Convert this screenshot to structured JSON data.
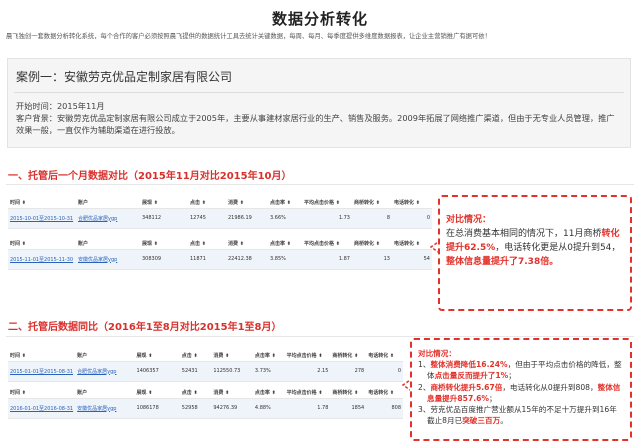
{
  "page": {
    "title": "数据分析转化",
    "intro": "晨飞独创一套数据分析转化系统，每个合作的客户必须按照晨飞提供的数据统计工具去统计关键数据，每周、每月、每季度提供多维度数据报表，让企业主营销推广有据可依！"
  },
  "case": {
    "title": "案例一：安徽劳克优品定制家居有限公司",
    "start_label": "开始时间：",
    "start_value": "2015年11月",
    "bg_label": "客户背景：",
    "bg_text": "安徽劳克优品定制家居有限公司成立于2005年，主要从事建材家居行业的生产、销售及服务。2009年拓展了网络推广渠道，但由于无专业人员管理，推广效果一般，一直仅作为辅助渠道在进行投放。"
  },
  "section1": {
    "heading": "一、托管后一个月数据对比（2015年11月对比2015年10月）",
    "headers": [
      "时间 ⬍",
      "账户",
      "展现 ⬍",
      "点击 ⬍",
      "消费 ⬍",
      "点击率 ⬍",
      "平均点击价格 ⬍",
      "商桥转化 ⬍",
      "电话转化 ⬍"
    ],
    "rows": [
      [
        "2015-10-01至2015-10-31",
        "合肥优品家居ygp",
        "348112",
        "12745",
        "21986.19",
        "3.66%",
        "1.73",
        "8",
        "0"
      ],
      [
        "2015-11-01至2015-11-30",
        "安徽优品家居ygp",
        "308309",
        "11871",
        "22412.38",
        "3.85%",
        "1.87",
        "13",
        "54"
      ]
    ],
    "callout": {
      "title": "对比情况：",
      "p1": "在总消费基本相同的情况下，11月商桥",
      "hl1": "转化提升62.5%",
      "p2": "，电话转化更是从0提升到54，",
      "hl2": "整体信息量提升了7.38倍。"
    }
  },
  "section2": {
    "heading": "二、托管后数据同比（2016年1至8月对比2015年1至8月）",
    "headers": [
      "时间 ⬍",
      "账户",
      "展现 ⬍",
      "点击 ⬍",
      "消费 ⬍",
      "点击率 ⬍",
      "平均点击价格 ⬍",
      "商桥转化 ⬍",
      "电话转化 ⬍"
    ],
    "rows": [
      [
        "2015-01-01至2015-08-31",
        "合肥优品家居ygp",
        "1406357",
        "52431",
        "112550.73",
        "3.73%",
        "2.15",
        "278",
        "0"
      ],
      [
        "2016-01-01至2016-08-31",
        "安徽优品家居ygp",
        "1086178",
        "52958",
        "94276.39",
        "4.88%",
        "1.78",
        "1854",
        "808"
      ]
    ],
    "callout": {
      "title": "对比情况：",
      "i1_a": "1、",
      "i1_hl": "整体消费降低16.24%",
      "i1_b": "，但由于平均点击价格的降低，整体",
      "i1_hl2": "点击量反而提升了1%",
      "i1_c": "；",
      "i2_a": "2、",
      "i2_hl": "商桥转化提升5.67倍",
      "i2_b": "，电话转化从0提升到808，",
      "i2_hl2": "整体信息量提升857.6%",
      "i2_c": "；",
      "i3_a": "3、劳克优品百度推广营业额从15年的不足十万提升到16年截止8月已",
      "i3_hl": "突破三百万",
      "i3_c": "。"
    }
  },
  "colors": {
    "accent_red": "#e3322b",
    "link_blue": "#2a62b9",
    "row_bg": "#eef4fa"
  }
}
